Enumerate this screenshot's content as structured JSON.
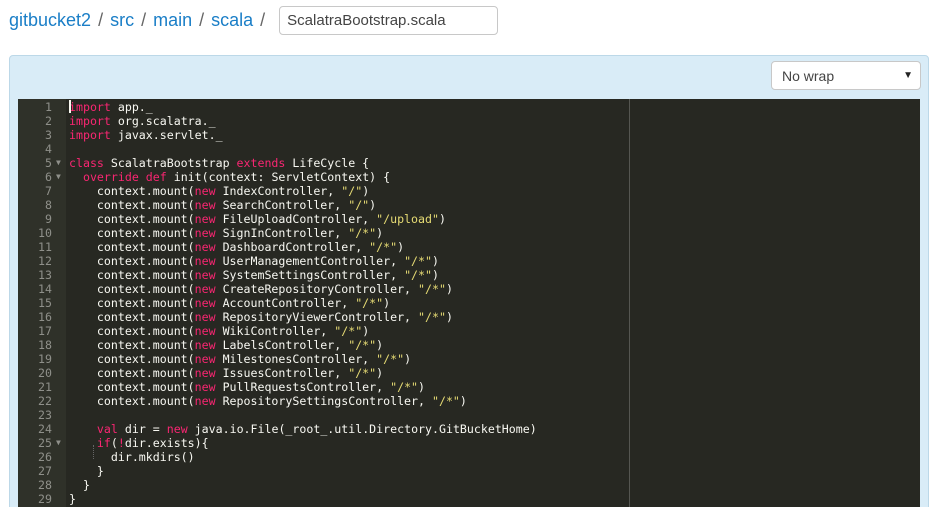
{
  "breadcrumb": {
    "items": [
      "gitbucket2",
      "src",
      "main",
      "scala"
    ],
    "separator": "/",
    "filename": "ScalatraBootstrap.scala"
  },
  "toolbar": {
    "wrap_mode": "No wrap"
  },
  "editor": {
    "language": "scala",
    "theme": "monokai",
    "lines": [
      "import app._",
      "import org.scalatra._",
      "import javax.servlet._",
      "",
      "class ScalatraBootstrap extends LifeCycle {",
      "  override def init(context: ServletContext) {",
      "    context.mount(new IndexController, \"/\")",
      "    context.mount(new SearchController, \"/\")",
      "    context.mount(new FileUploadController, \"/upload\")",
      "    context.mount(new SignInController, \"/*\")",
      "    context.mount(new DashboardController, \"/*\")",
      "    context.mount(new UserManagementController, \"/*\")",
      "    context.mount(new SystemSettingsController, \"/*\")",
      "    context.mount(new CreateRepositoryController, \"/*\")",
      "    context.mount(new AccountController, \"/*\")",
      "    context.mount(new RepositoryViewerController, \"/*\")",
      "    context.mount(new WikiController, \"/*\")",
      "    context.mount(new LabelsController, \"/*\")",
      "    context.mount(new MilestonesController, \"/*\")",
      "    context.mount(new IssuesController, \"/*\")",
      "    context.mount(new PullRequestsController, \"/*\")",
      "    context.mount(new RepositorySettingsController, \"/*\")",
      "",
      "    val dir = new java.io.File(_root_.util.Directory.GitBucketHome)",
      "    if(!dir.exists){",
      "      dir.mkdirs()",
      "    }",
      "  }",
      "}"
    ],
    "fold_lines": [
      5,
      6,
      25
    ]
  }
}
